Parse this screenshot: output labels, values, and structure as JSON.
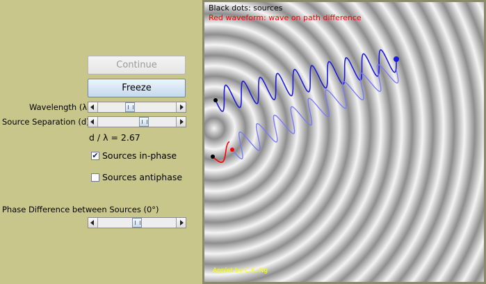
{
  "controls": {
    "continue_label": "Continue",
    "freeze_label": "Freeze",
    "wavelength_label": "Wavelength (λ)",
    "wavelength_value": 0.4,
    "separation_label": "Source Separation (d)",
    "separation_value": 0.6,
    "ratio_text": "d  / λ   = 2.67",
    "inphase_label": "Sources in-phase",
    "inphase_checked": "✔",
    "antiphase_label": "Sources antiphase",
    "phase_label": "Phase Difference between Sources (0°)",
    "phase_value": 0.5
  },
  "simulation": {
    "legend_black": "Black dots: sources",
    "legend_red": "Red waveform: wave on path difference",
    "credit": "Applet by C.K. Ng",
    "colors": {
      "black_text": "#000000",
      "red_text": "#ff0000",
      "credit_text": "#ffff00",
      "wave_blue": "#1a1adc",
      "wave_light_blue": "#7a7aff",
      "wave_red": "#ff0000"
    }
  }
}
